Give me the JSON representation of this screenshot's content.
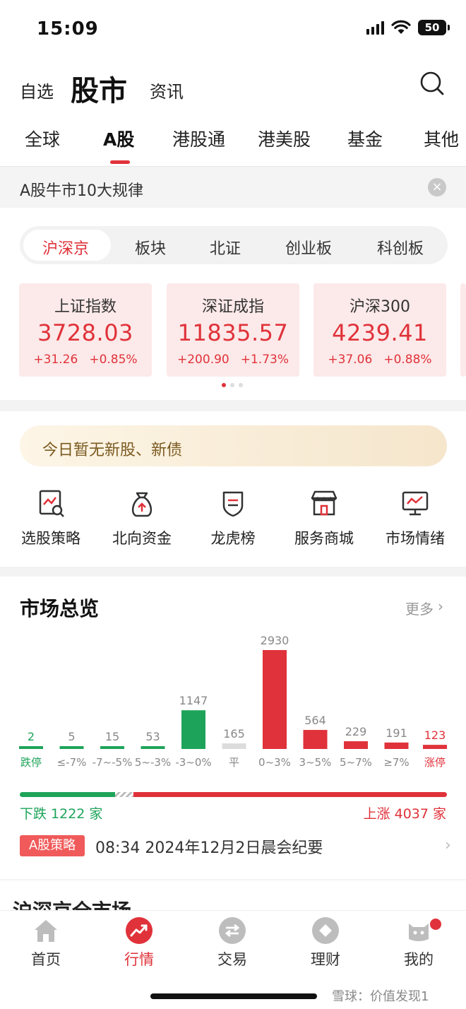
{
  "status": {
    "time": "15:09",
    "battery": "50"
  },
  "header": {
    "nav_left": "自选",
    "nav_main": "股市",
    "nav_right": "资讯"
  },
  "market_tabs": [
    "全球",
    "A股",
    "港股通",
    "港美股",
    "基金",
    "其他"
  ],
  "banner": {
    "text": "A股牛市10大规律",
    "close": "×"
  },
  "segments": [
    "沪深京",
    "板块",
    "北证",
    "创业板",
    "科创板"
  ],
  "indices": [
    {
      "name": "上证指数",
      "value": "3728.03",
      "change": "+31.26",
      "pct": "+0.85%"
    },
    {
      "name": "深证成指",
      "value": "11835.57",
      "change": "+200.90",
      "pct": "+1.73%"
    },
    {
      "name": "沪深300",
      "value": "4239.41",
      "change": "+37.06",
      "pct": "+0.88%"
    }
  ],
  "new_stock": "今日暂无新股、新债",
  "tools": [
    {
      "label": "选股策略",
      "icon": "stock-picker-icon"
    },
    {
      "label": "北向资金",
      "icon": "money-bag-icon"
    },
    {
      "label": "龙虎榜",
      "icon": "shield-list-icon"
    },
    {
      "label": "服务商城",
      "icon": "store-icon"
    },
    {
      "label": "市场情绪",
      "icon": "monitor-chart-icon"
    }
  ],
  "market_overview": {
    "title": "市场总览",
    "more": "更多",
    "more_arrow": "›"
  },
  "chart_data": {
    "type": "bar",
    "categories": [
      "跌停",
      "≤-7%",
      "-7~-5%",
      "5~-3%",
      "-3~0%",
      "平",
      "0~3%",
      "3~5%",
      "5~7%",
      "≥7%",
      "涨停"
    ],
    "values": [
      2,
      5,
      15,
      53,
      1147,
      165,
      2930,
      564,
      229,
      191,
      123
    ],
    "colors": [
      "#1ea45a",
      "#1ea45a",
      "#1ea45a",
      "#1ea45a",
      "#1ea45a",
      "#dcdcdc",
      "#e0323a",
      "#e0323a",
      "#e0323a",
      "#e0323a",
      "#e0323a"
    ],
    "label_colors": [
      "#1ea45a",
      "#888888",
      "#888888",
      "#888888",
      "#888888",
      "#888888",
      "#888888",
      "#888888",
      "#888888",
      "#888888",
      "#e0323a"
    ],
    "value_colors": [
      "#1ea45a",
      "#888888",
      "#888888",
      "#888888",
      "#888888",
      "#888888",
      "#888888",
      "#888888",
      "#888888",
      "#888888",
      "#e0323a"
    ],
    "ylim": [
      0,
      2930
    ]
  },
  "breadth": {
    "down_label": "下跌 1222 家",
    "up_label": "上涨 4037 家",
    "down": 1222,
    "up": 4037
  },
  "strategy": {
    "tag": "A股策略",
    "text": "08:34 2024年12月2日晨会纪要",
    "arrow": "›"
  },
  "next_section_title": "沪深京全市场",
  "bottom_tabs": [
    {
      "label": "首页",
      "icon": "home-icon"
    },
    {
      "label": "行情",
      "icon": "market-trend-icon"
    },
    {
      "label": "交易",
      "icon": "trade-icon"
    },
    {
      "label": "理财",
      "icon": "wealth-icon"
    },
    {
      "label": "我的",
      "icon": "profile-icon"
    }
  ],
  "watermark": "雪球：价值发现1",
  "colors": {
    "up": "#e0323a",
    "down": "#1ea45a",
    "flat": "#dcdcdc"
  }
}
